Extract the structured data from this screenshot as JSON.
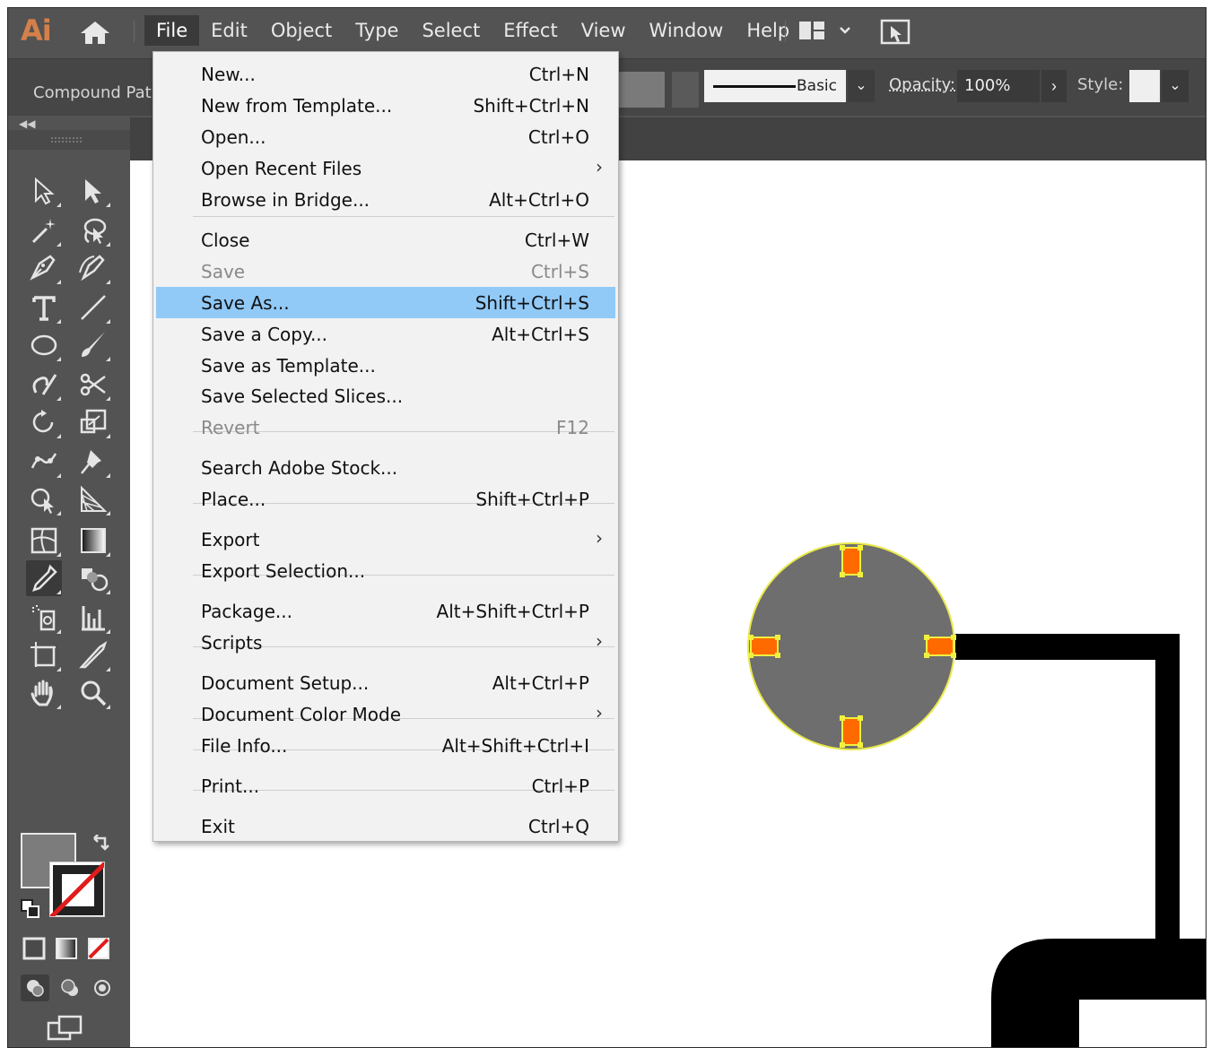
{
  "app": {
    "logo": "Ai",
    "menus": [
      "File",
      "Edit",
      "Object",
      "Type",
      "Select",
      "Effect",
      "View",
      "Window",
      "Help"
    ],
    "active_menu": "File"
  },
  "control_bar": {
    "selection_type": "Compound Path",
    "brush_label": "Basic",
    "opacity_label": "Opacity:",
    "opacity_value": "100%",
    "style_label": "Style:"
  },
  "file_menu": {
    "items": [
      {
        "label": "New...",
        "shortcut": "Ctrl+N"
      },
      {
        "label": "New from Template...",
        "shortcut": "Shift+Ctrl+N"
      },
      {
        "label": "Open...",
        "shortcut": "Ctrl+O"
      },
      {
        "label": "Open Recent Files",
        "shortcut": "",
        "submenu": true
      },
      {
        "label": "Browse in Bridge...",
        "shortcut": "Alt+Ctrl+O"
      },
      {
        "label": "Close",
        "shortcut": "Ctrl+W"
      },
      {
        "label": "Save",
        "shortcut": "Ctrl+S",
        "disabled": true
      },
      {
        "label": "Save As...",
        "shortcut": "Shift+Ctrl+S",
        "highlighted": true
      },
      {
        "label": "Save a Copy...",
        "shortcut": "Alt+Ctrl+S"
      },
      {
        "label": "Save as Template...",
        "shortcut": ""
      },
      {
        "label": "Save Selected Slices...",
        "shortcut": ""
      },
      {
        "label": "Revert",
        "shortcut": "F12",
        "disabled": true
      },
      {
        "label": "Search Adobe Stock...",
        "shortcut": ""
      },
      {
        "label": "Place...",
        "shortcut": "Shift+Ctrl+P"
      },
      {
        "label": "Export",
        "shortcut": "",
        "submenu": true
      },
      {
        "label": "Export Selection...",
        "shortcut": ""
      },
      {
        "label": "Package...",
        "shortcut": "Alt+Shift+Ctrl+P"
      },
      {
        "label": "Scripts",
        "shortcut": "",
        "submenu": true
      },
      {
        "label": "Document Setup...",
        "shortcut": "Alt+Ctrl+P"
      },
      {
        "label": "Document Color Mode",
        "shortcut": "",
        "submenu": true
      },
      {
        "label": "File Info...",
        "shortcut": "Alt+Shift+Ctrl+I"
      },
      {
        "label": "Print...",
        "shortcut": "Ctrl+P"
      },
      {
        "label": "Exit",
        "shortcut": "Ctrl+Q"
      }
    ]
  },
  "tools": [
    "selection-tool",
    "direct-selection-tool",
    "magic-wand-tool",
    "lasso-tool",
    "pen-tool",
    "curvature-tool",
    "type-tool",
    "line-segment-tool",
    "ellipse-tool",
    "paintbrush-tool",
    "shaper-tool",
    "scissors-tool",
    "rotate-tool",
    "scale-tool",
    "puppet-warp-tool",
    "pin-tool",
    "shape-builder-tool",
    "perspective-grid-tool",
    "mesh-tool",
    "gradient-tool",
    "eyedropper-tool",
    "blend-tool",
    "symbol-sprayer-tool",
    "column-graph-tool",
    "artboard-tool",
    "slice-tool",
    "hand-tool",
    "zoom-tool"
  ],
  "colors": {
    "fill": "#7c7c7c",
    "accent_highlight": "#91c9f7",
    "anchor": "#ff6600",
    "selection": "#f0f040"
  }
}
